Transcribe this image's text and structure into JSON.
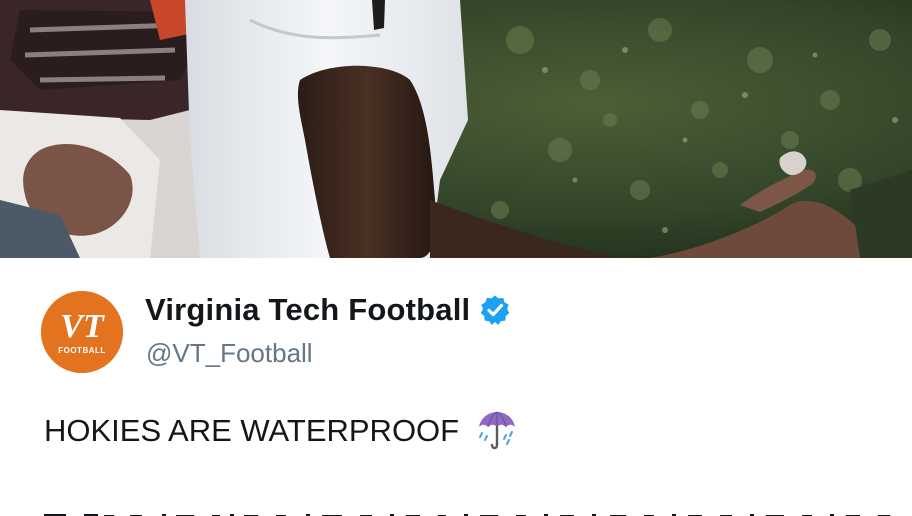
{
  "tweet": {
    "display_name": "Virginia Tech Football",
    "handle": "@VT_Football",
    "text": "HOKIES ARE WATERPROOF",
    "emoji": "umbrella-with-rain-drops-emoji",
    "verified": true
  },
  "avatar": {
    "logo_text": "VT",
    "logo_subtext": "FOOTBALL",
    "color": "#e4731f"
  },
  "media": {
    "description_icon": "photo-media"
  },
  "colors": {
    "name": "#14171a",
    "handle": "#657786",
    "verified_badge": "#1da1f2",
    "avatar_bg": "#e4731f",
    "umbrella": "#8e6bbf"
  }
}
